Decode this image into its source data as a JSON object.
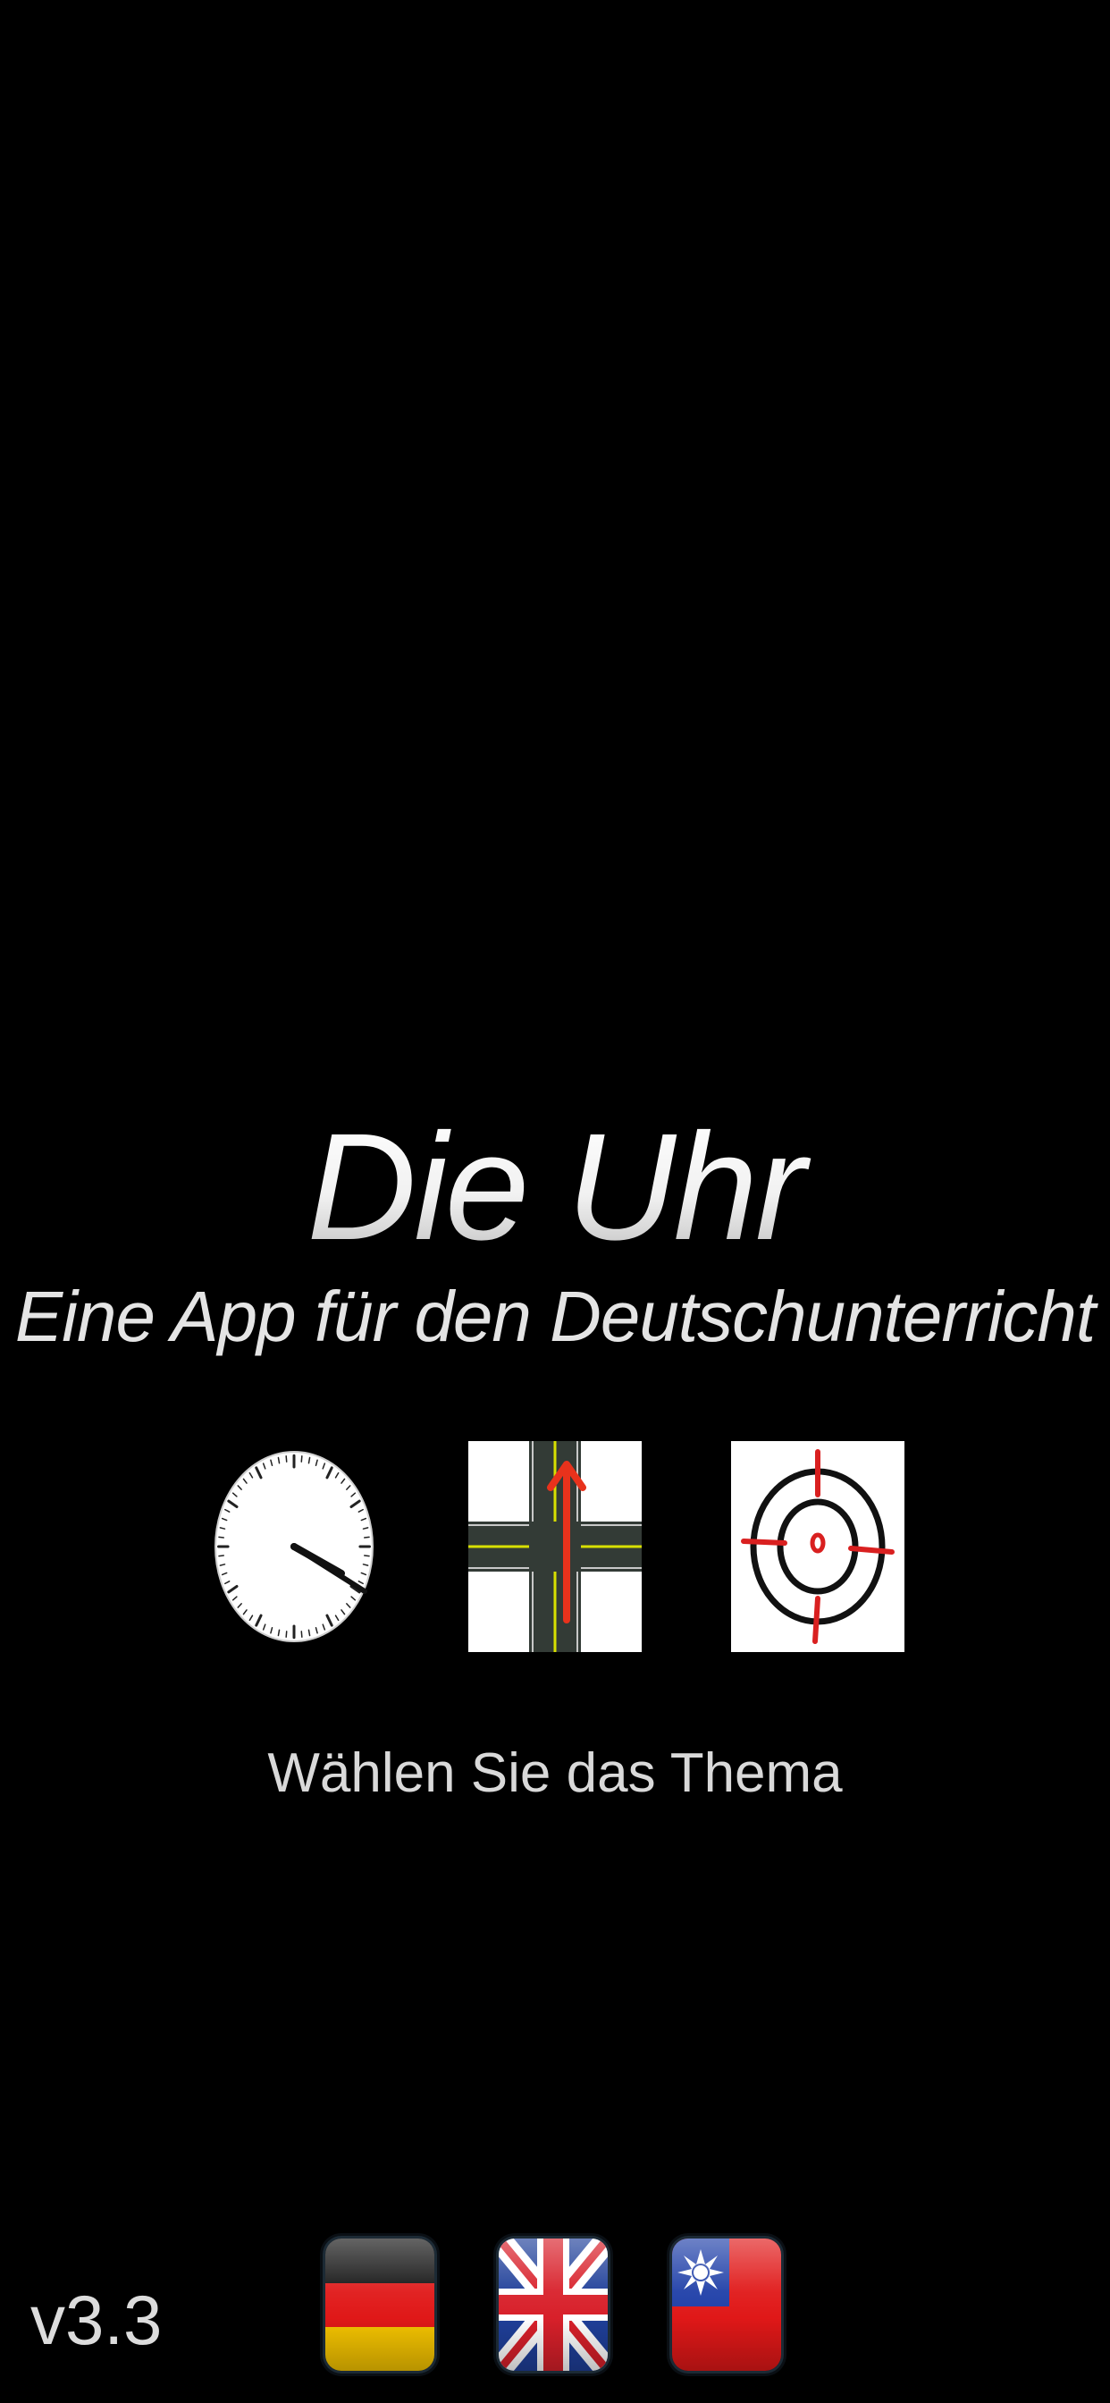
{
  "app": {
    "title": "Die Uhr",
    "subtitle": "Eine App für den Deutschunterricht",
    "version": "v3.3"
  },
  "topics": [
    {
      "icon": "clock-icon"
    },
    {
      "icon": "crossroads-arrow-icon"
    },
    {
      "icon": "target-crosshair-icon"
    }
  ],
  "prompt": "Wählen Sie das Thema",
  "languages": [
    {
      "icon": "germany-flag-icon"
    },
    {
      "icon": "uk-flag-icon"
    },
    {
      "icon": "taiwan-flag-icon"
    }
  ],
  "colors": {
    "background": "#000000",
    "text": "#e6e6e6",
    "arrow_red": "#e8321c",
    "road_dark": "#333b36",
    "road_line": "#d8e000"
  }
}
